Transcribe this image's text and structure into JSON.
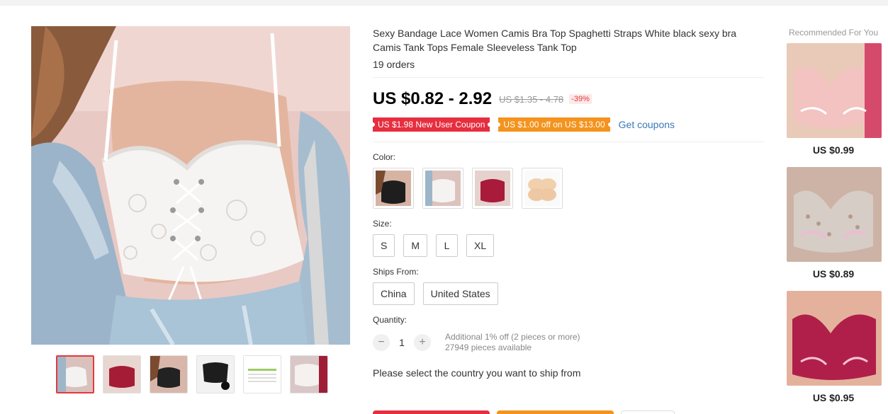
{
  "product": {
    "title": "Sexy Bandage Lace Women Camis Bra Top Spaghetti Straps White black sexy bra Camis Tank Tops Female Sleeveless Tank Top",
    "orders": "19 orders",
    "price": "US $0.82 - 2.92",
    "original_price": "US $1.35 - 4.78",
    "discount": "-39%"
  },
  "coupons": {
    "new_user": "US $1.98 New User Coupon",
    "store": "US $1.00 off on US $13.00",
    "get_link": "Get coupons"
  },
  "color": {
    "label": "Color:",
    "swatches": [
      "black-lace",
      "white-lace",
      "red-lace",
      "nude-pads"
    ]
  },
  "size": {
    "label": "Size:",
    "options": [
      "S",
      "M",
      "L",
      "XL"
    ]
  },
  "ships_from": {
    "label": "Ships From:",
    "options": [
      "China",
      "United States"
    ]
  },
  "quantity": {
    "label": "Quantity:",
    "value": "1",
    "minus": "−",
    "plus": "+",
    "note1": "Additional 1% off (2 pieces or more)",
    "note2": "27949 pieces available"
  },
  "shipping_prompt": "Please select the country you want to ship from",
  "recommended": {
    "title": "Recommended For You",
    "items": [
      {
        "price": "US $0.99",
        "color": "#f2c3c0"
      },
      {
        "price": "US $0.89",
        "color": "#d6cdc6"
      },
      {
        "price": "US $0.95",
        "color": "#b01f4a"
      }
    ]
  },
  "colors": {
    "accent_red": "#e62e3f",
    "accent_orange": "#f4931e",
    "link_blue": "#3a7ab8"
  }
}
